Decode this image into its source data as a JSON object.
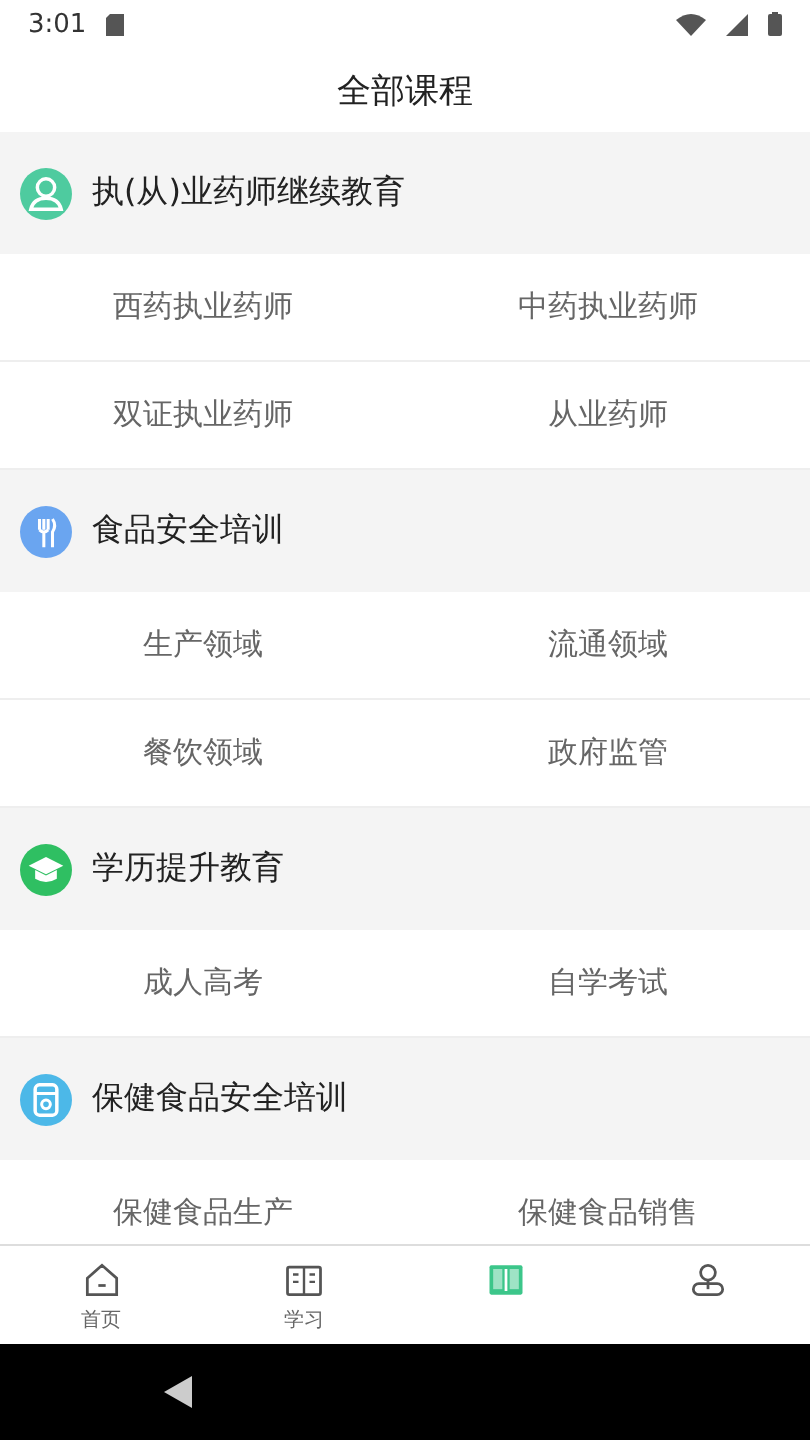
{
  "status_bar": {
    "time": "3:01"
  },
  "header": {
    "title": "全部课程"
  },
  "sections": [
    {
      "title": "执(从)业药师继续教育",
      "color": "#4ecb9f",
      "items": [
        "西药执业药师",
        "中药执业药师",
        "双证执业药师",
        "从业药师"
      ]
    },
    {
      "title": "食品安全培训",
      "color": "#6aa5f0",
      "items": [
        "生产领域",
        "流通领域",
        "餐饮领域",
        "政府监管"
      ]
    },
    {
      "title": "学历提升教育",
      "color": "#2fbf62",
      "items": [
        "成人高考",
        "自学考试"
      ]
    },
    {
      "title": "保健食品安全培训",
      "color": "#4cb8e8",
      "items": [
        "保健食品生产",
        "保健食品销售"
      ]
    }
  ],
  "tabs": [
    {
      "label": "首页",
      "selected": false
    },
    {
      "label": "学习",
      "selected": false
    },
    {
      "selected": true
    },
    {
      "selected": false
    }
  ]
}
